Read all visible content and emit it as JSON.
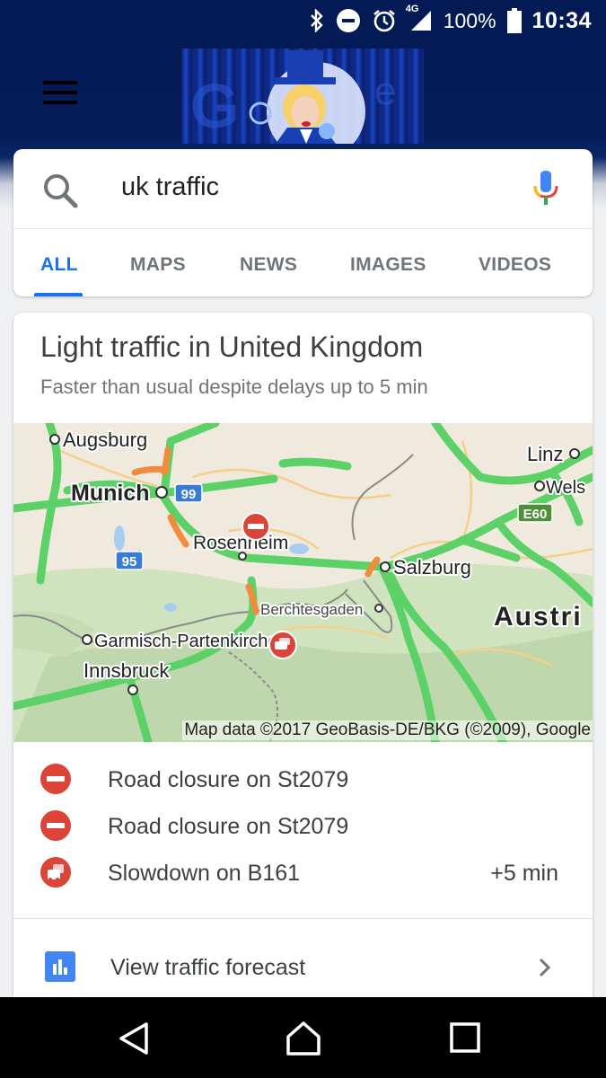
{
  "status_bar": {
    "network": "4G",
    "battery_percent": "100%",
    "time": "10:34"
  },
  "search": {
    "query": "uk traffic"
  },
  "tabs": [
    {
      "label": "ALL",
      "active": true
    },
    {
      "label": "MAPS",
      "active": false
    },
    {
      "label": "NEWS",
      "active": false
    },
    {
      "label": "IMAGES",
      "active": false
    },
    {
      "label": "VIDEOS",
      "active": false
    }
  ],
  "result": {
    "title": "Light traffic in United Kingdom",
    "subtitle": "Faster than usual despite delays up to 5 min",
    "map": {
      "places": [
        "Augsburg",
        "Munich",
        "Rosenheim",
        "Salzburg",
        "Linz",
        "Wels",
        "Berchtesgaden",
        "Garmisch-Partenkirchen",
        "Innsbruck",
        "Austri"
      ],
      "road_shields": [
        "99",
        "95",
        "E60"
      ],
      "attribution": "Map data ©2017 GeoBasis-DE/BKG (©2009), Google"
    },
    "incidents": [
      {
        "label": "Road closure on St2079",
        "delay": "",
        "icon": "road-closure-icon"
      },
      {
        "label": "Road closure on St2079",
        "delay": "",
        "icon": "road-closure-icon"
      },
      {
        "label": "Slowdown on B161",
        "delay": "+5 min",
        "icon": "slowdown-car-icon"
      }
    ],
    "forecast_label": "View traffic forecast"
  },
  "colors": {
    "accent": "#1a73e8",
    "traffic_green": "#5bd168",
    "traffic_orange": "#f08c3c",
    "incident_red": "#db4437"
  }
}
